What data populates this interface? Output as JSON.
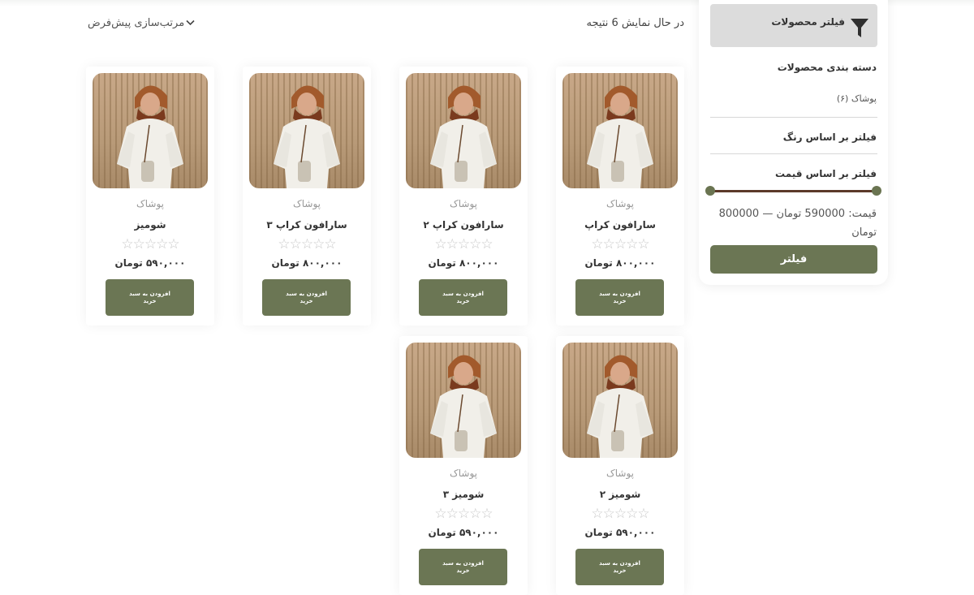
{
  "sidebar": {
    "filter_title": "فیلتر محصولات",
    "category_heading": "دسته بندی محصولات",
    "category_item": "پوشاک (۶)",
    "color_filter": "فیلتر بر اساس رنگ",
    "price_filter": "فیلتر بر اساس قیمت",
    "price_range": "قیمت: 590000 تومان — 800000 تومان",
    "filter_button": "فیلتر",
    "slider_min": 590000,
    "slider_max": 800000
  },
  "toolbar": {
    "results_text": "در حال نمایش 6 نتیجه",
    "sort_label": "مرتب‌سازی پیش‌فرض"
  },
  "products": [
    {
      "category": "پوشاک",
      "name": "سارافون کراپ",
      "price": "۸۰۰,۰۰۰ تومان",
      "button": "افزودن به سبد خرید",
      "rating": 0
    },
    {
      "category": "پوشاک",
      "name": "سارافون کراپ ۲",
      "price": "۸۰۰,۰۰۰ تومان",
      "button": "افزودن به سبد خرید",
      "rating": 0
    },
    {
      "category": "پوشاک",
      "name": "سارافون کراپ ۳",
      "price": "۸۰۰,۰۰۰ تومان",
      "button": "افزودن به سبد خرید",
      "rating": 0
    },
    {
      "category": "پوشاک",
      "name": "شومیز",
      "price": "۵۹۰,۰۰۰ تومان",
      "button": "افزودن به سبد خرید",
      "rating": 0
    },
    {
      "category": "پوشاک",
      "name": "شومیز ۲",
      "price": "۵۹۰,۰۰۰ تومان",
      "button": "افزودن به سبد خرید",
      "rating": 0
    },
    {
      "category": "پوشاک",
      "name": "شومیز ۳",
      "price": "۵۹۰,۰۰۰ تومان",
      "button": "افزودن به سبد خرید",
      "rating": 0
    }
  ],
  "stars_glyph": "☆☆☆☆☆",
  "icons": {
    "filter": "funnel-icon",
    "sort": "chevron-down-icon"
  },
  "colors": {
    "accent": "#6b7654",
    "slider": "#5c3a2a",
    "handle": "#6a7451"
  }
}
